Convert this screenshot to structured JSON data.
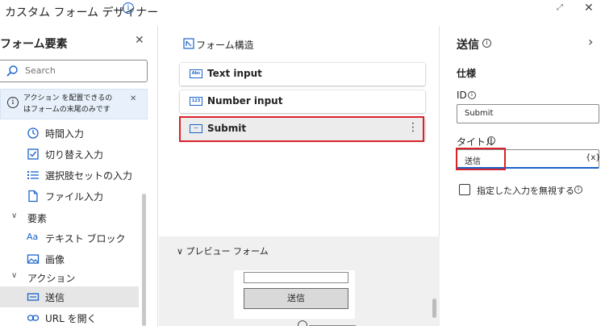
{
  "window": {
    "title": "カスタム フォーム デザイナー",
    "info_glyph": "i",
    "expand_glyph": "⤢",
    "close_glyph": "✕"
  },
  "left_panel": {
    "title": "フォーム要素",
    "close_glyph": "✕",
    "search_placeholder": "Search",
    "notice": {
      "icon_glyph": "i",
      "text_line1": "アクション を配置できるの",
      "text_line2": "はフォームの末尾のみです",
      "close_glyph": "✕"
    },
    "items": [
      {
        "label": "時間入力",
        "icon": "clock-icon"
      },
      {
        "label": "切り替え入力",
        "icon": "checkbox-icon"
      },
      {
        "label": "選択肢セットの入力",
        "icon": "list-icon"
      },
      {
        "label": "ファイル入力",
        "icon": "file-icon"
      }
    ],
    "group_elements": {
      "label": "要素",
      "chev": "∨"
    },
    "element_items": [
      {
        "label": "テキスト ブロック",
        "icon_text": "Aa"
      },
      {
        "label": "画像",
        "icon": "image-icon"
      }
    ],
    "group_actions": {
      "label": "アクション",
      "chev": "∨"
    },
    "action_items": [
      {
        "label": "送信",
        "icon": "submit-icon",
        "selected": true
      },
      {
        "label": "URL を開く",
        "icon": "link-icon"
      }
    ]
  },
  "middle_panel": {
    "header": "フォーム構造",
    "fields": [
      {
        "label": "Text input",
        "icon_text": "Abc"
      },
      {
        "label": "Number input",
        "icon_text": "123"
      },
      {
        "label": "Submit",
        "icon_text": "—",
        "selected": true
      }
    ],
    "more_glyph": "⋮",
    "preview": {
      "header": "∨ プレビュー フォーム",
      "button_label": "送信"
    }
  },
  "right_panel": {
    "title": "送信",
    "info_glyph": "i",
    "chevron": "›",
    "section": "仕様",
    "id_label": "ID",
    "id_value": "Submit",
    "title_label": "タイトル",
    "title_value": "送信",
    "fx_label": "{x}",
    "checkbox_label": "指定した入力を無視する"
  },
  "colors": {
    "accent": "#1a63c9",
    "highlight_red": "#d8232a",
    "selection_bg": "#e6e6e6"
  }
}
